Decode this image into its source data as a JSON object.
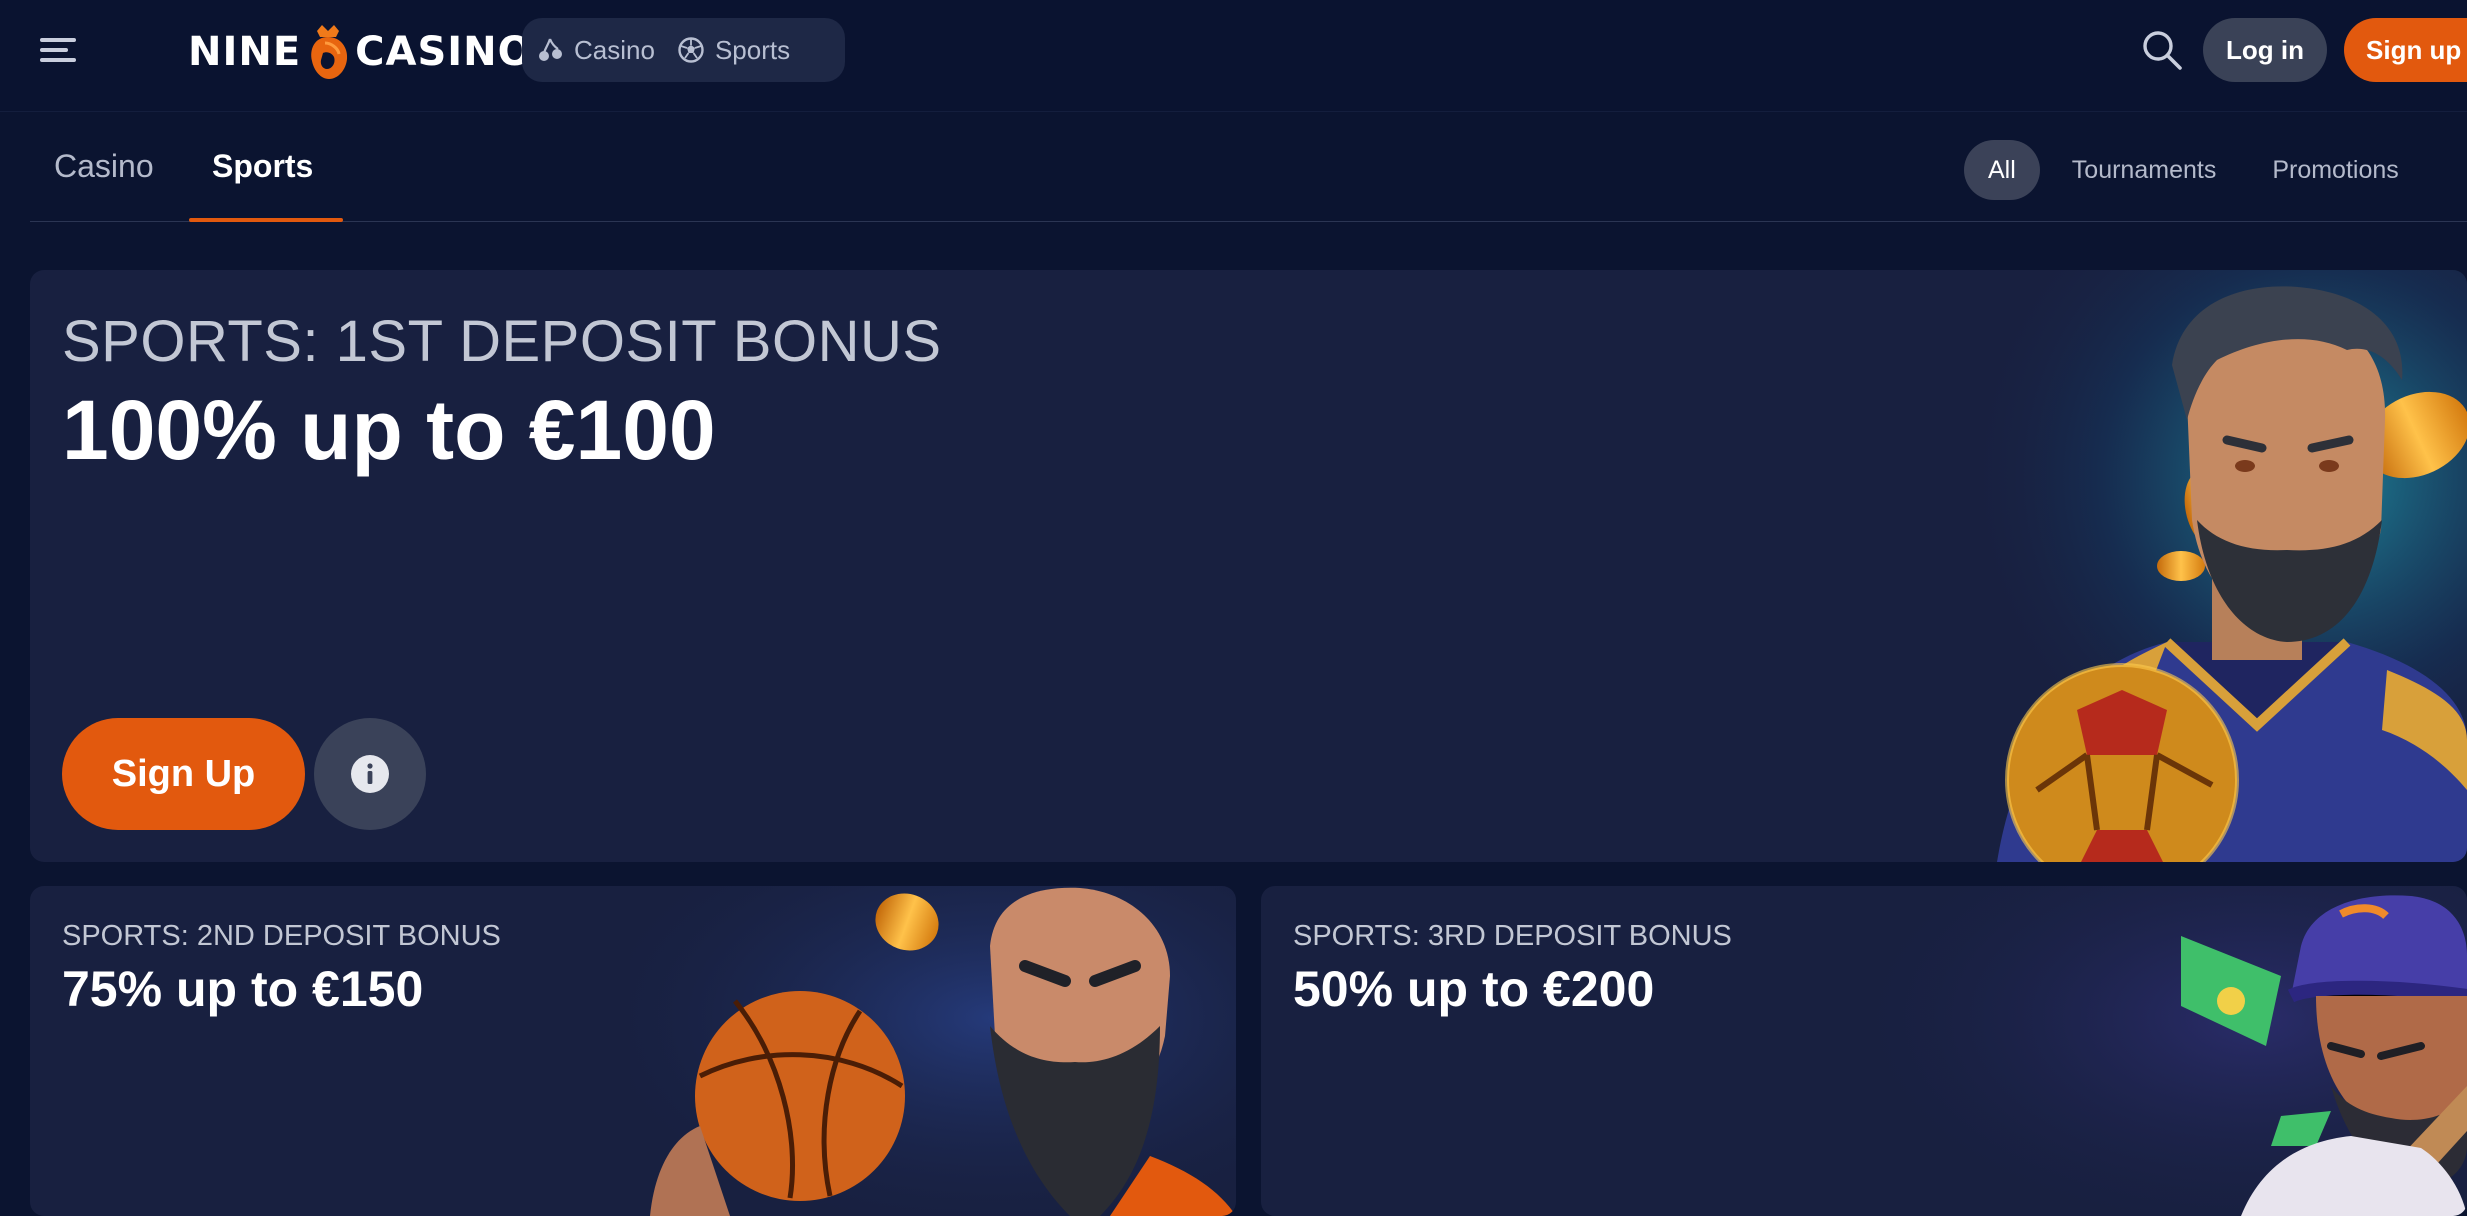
{
  "header": {
    "logo_left": "NINE",
    "logo_right": "CASINO",
    "verticals": [
      {
        "label": "Casino",
        "icon": "cherries-icon"
      },
      {
        "label": "Sports",
        "icon": "football-icon"
      }
    ],
    "login_label": "Log in",
    "signup_label": "Sign up"
  },
  "subnav": {
    "tabs": [
      {
        "label": "Casino",
        "active": false
      },
      {
        "label": "Sports",
        "active": true
      }
    ],
    "filters": [
      {
        "label": "All",
        "active": true
      },
      {
        "label": "Tournaments",
        "active": false
      },
      {
        "label": "Promotions",
        "active": false
      }
    ]
  },
  "promos": {
    "hero": {
      "subtitle": "SPORTS: 1ST DEPOSIT BONUS",
      "title": "100% up to €100",
      "cta_label": "Sign Up",
      "info_icon": "info-icon"
    },
    "cards": [
      {
        "subtitle": "SPORTS: 2ND DEPOSIT BONUS",
        "title": "75% up to €150"
      },
      {
        "subtitle": "SPORTS: 3RD DEPOSIT BONUS",
        "title": "50% up to €200"
      }
    ]
  },
  "colors": {
    "accent": "#e2590e",
    "background": "#0b1430",
    "card": "#182040",
    "pill": "#3b4258"
  }
}
